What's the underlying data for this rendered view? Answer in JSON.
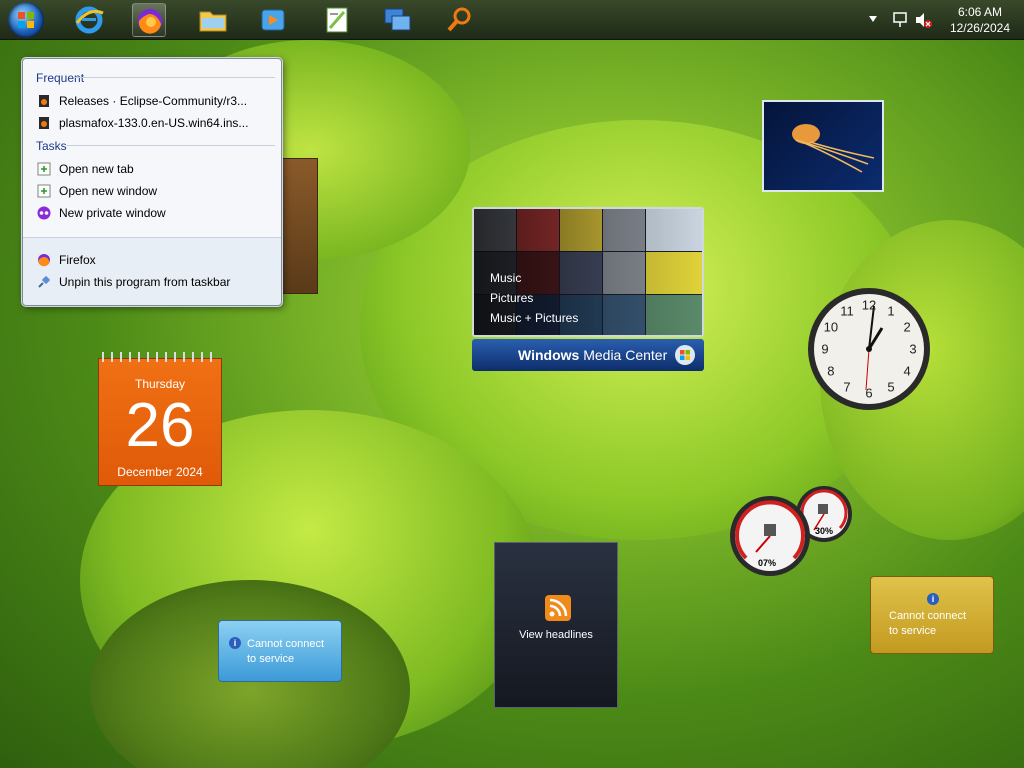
{
  "taskbar": {
    "pinned": [
      {
        "name": "internet-explorer"
      },
      {
        "name": "firefox",
        "active": true
      },
      {
        "name": "file-explorer"
      },
      {
        "name": "media-player"
      },
      {
        "name": "notepad-plus-plus"
      },
      {
        "name": "remote-desktop"
      },
      {
        "name": "search"
      }
    ],
    "clock": {
      "time": "6:06 AM",
      "date": "12/26/2024"
    }
  },
  "jumplist": {
    "frequent_heading": "Frequent",
    "frequent": [
      {
        "label": "Releases · Eclipse-Community/r3..."
      },
      {
        "label": "plasmafox-133.0.en-US.win64.ins..."
      }
    ],
    "tasks_heading": "Tasks",
    "tasks": [
      {
        "label": "Open new tab"
      },
      {
        "label": "Open new window"
      },
      {
        "label": "New private window"
      }
    ],
    "bottom": [
      {
        "label": "Firefox"
      },
      {
        "label": "Unpin this program from taskbar"
      }
    ]
  },
  "gadgets": {
    "calendar": {
      "weekday": "Thursday",
      "day": "26",
      "month_year": "December 2024"
    },
    "media_center": {
      "items": [
        "Music",
        "Pictures",
        "Music + Pictures"
      ],
      "brand_a": "Windows",
      "brand_b": "Media Center"
    },
    "clock": {
      "numerals": [
        "12",
        "1",
        "2",
        "3",
        "4",
        "5",
        "6",
        "7",
        "8",
        "9",
        "10",
        "11"
      ]
    },
    "cpu_meter": {
      "cpu": "07%",
      "memory": "30%"
    },
    "feed": {
      "label": "View headlines"
    },
    "weather": {
      "line1": "Cannot connect",
      "line2": "to service"
    },
    "currency": {
      "line1": "Cannot connect",
      "line2": "to service"
    }
  }
}
